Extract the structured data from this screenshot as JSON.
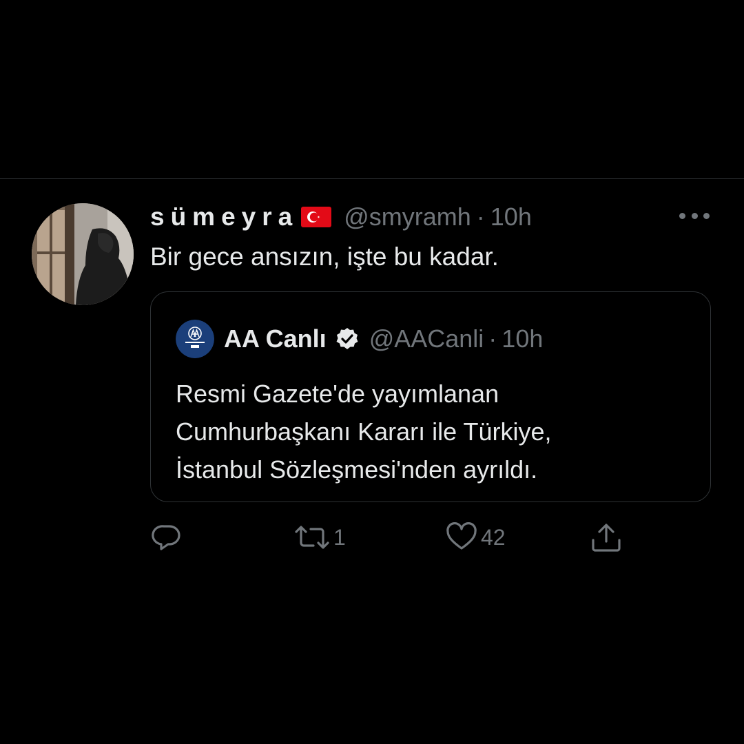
{
  "tweet": {
    "display_name": "sümeyra",
    "handle": "@smyramh",
    "separator": "·",
    "time": "10h",
    "text": "Bir gece ansızın, işte bu kadar.",
    "flag_icon": "turkey-flag-icon",
    "more_icon": "more-options-icon"
  },
  "quote": {
    "display_name": "AA Canlı",
    "handle": "@AACanli",
    "separator": "·",
    "time": "10h",
    "verified_icon": "verified-badge-icon",
    "text_lines": [
      "Resmi Gazete'de yayımlanan",
      "Cumhurbaşkanı Kararı ile Türkiye,",
      "İstanbul Sözleşmesi'nden ayrıldı."
    ]
  },
  "actions": {
    "reply_icon": "reply-icon",
    "retweet_icon": "retweet-icon",
    "retweet_count": "1",
    "like_icon": "heart-icon",
    "like_count": "42",
    "share_icon": "share-icon"
  },
  "colors": {
    "background": "#000000",
    "text_primary": "#e7e9ea",
    "text_secondary": "#71767b",
    "border": "#2f3336",
    "aa_blue": "#1b3f7a",
    "flag_red": "#e30a17"
  }
}
